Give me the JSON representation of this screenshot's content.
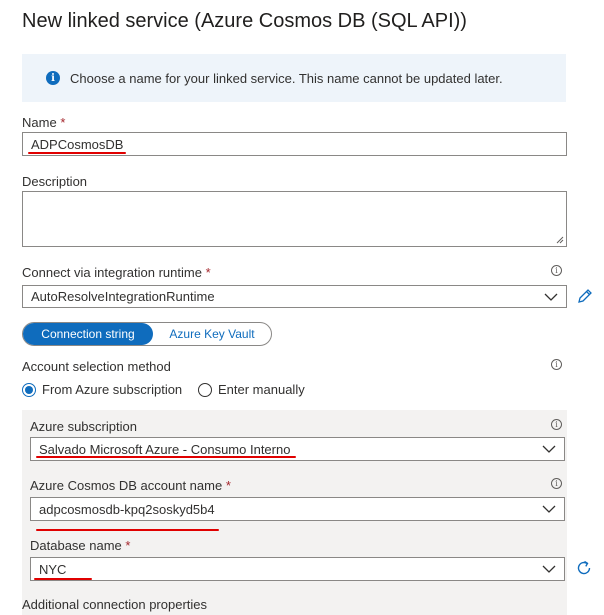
{
  "title": "New linked service (Azure Cosmos DB (SQL API))",
  "info_banner": {
    "icon": "info-icon",
    "text": "Choose a name for your linked service. This name cannot be updated later."
  },
  "name": {
    "label": "Name",
    "required_mark": "*",
    "value": "ADPCosmosDB"
  },
  "description": {
    "label": "Description",
    "value": ""
  },
  "runtime": {
    "label": "Connect via integration runtime",
    "required_mark": "*",
    "value": "AutoResolveIntegrationRuntime",
    "edit_icon": "pencil-icon"
  },
  "connection_toggle": {
    "selected": "Connection string",
    "other": "Azure Key Vault"
  },
  "account_selection": {
    "label": "Account selection method",
    "options": [
      "From Azure subscription",
      "Enter manually"
    ],
    "selected_index": 0
  },
  "azure_subscription": {
    "label": "Azure subscription",
    "value": "Salvado Microsoft Azure - Consumo Interno"
  },
  "cosmos_account": {
    "label": "Azure Cosmos DB account name",
    "required_mark": "*",
    "value": "adpcosmosdb-kpq2soskyd5b4"
  },
  "database": {
    "label": "Database name",
    "required_mark": "*",
    "value": "NYC",
    "refresh_icon": "refresh-icon"
  },
  "additional": {
    "label": "Additional connection properties"
  },
  "colors": {
    "accent": "#0f6cbd",
    "annotation": "#e00000",
    "panel": "#f3f2f1"
  }
}
